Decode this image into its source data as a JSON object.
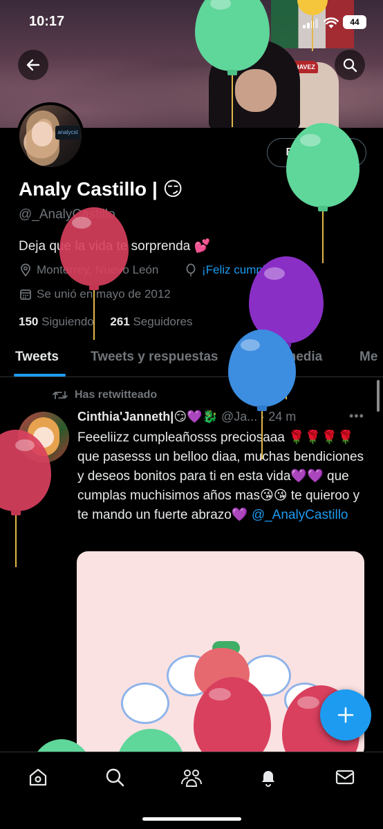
{
  "status_bar": {
    "time": "10:17",
    "battery": "44"
  },
  "profile": {
    "name": "Analy Castillo | 😏",
    "handle": "@_AnalyCastillo",
    "bio": "Deja que la vida te sorprenda 💕",
    "location": "Monterrey, Nuevo León",
    "birthday": "¡Feliz cumpleaños!",
    "joined": "Se unió en mayo de 2012",
    "following_count": "150",
    "following_label": "Siguiendo",
    "followers_count": "261",
    "followers_label": "Seguidores",
    "edit_button": "Editar perfil",
    "avatar_sign": "analycst"
  },
  "banner": {
    "cap_text": "C. CHAVEZ"
  },
  "tabs": [
    {
      "label": "Tweets"
    },
    {
      "label": "Tweets y respuestas"
    },
    {
      "label": "Multimedia"
    },
    {
      "label": "Me"
    }
  ],
  "tweet": {
    "retweet_label": "Has retwitteado",
    "author": "Cinthia'Janneth|😏💜🐉",
    "handle_time": "@Ja... · 24 m",
    "text": "Feeeliizz cumpleañosss preciosaaa 🌹🌹🌹🌹 que pasesss un belloo diaa, muchas bendiciones y deseos bonitos para ti en esta vida💜💜 que cumplas muchisimos años mas😘😘 te quieroo y te mando un fuerte abrazo💜 ",
    "mention": "@_AnalyCastillo"
  },
  "colors": {
    "accent": "#1d9bf0",
    "balloon_green": "#5fd69a",
    "balloon_red": "#d9405e",
    "balloon_purple": "#8a2fc6",
    "balloon_blue": "#3d8de0"
  },
  "icons": {
    "back": "back-arrow-icon",
    "search": "search-icon",
    "location": "location-pin-icon",
    "balloon": "balloon-icon",
    "calendar": "calendar-icon",
    "retweet": "retweet-icon",
    "compose": "plus-icon",
    "nav": [
      "home-icon",
      "search-icon",
      "communities-icon",
      "bell-icon",
      "mail-icon"
    ]
  }
}
